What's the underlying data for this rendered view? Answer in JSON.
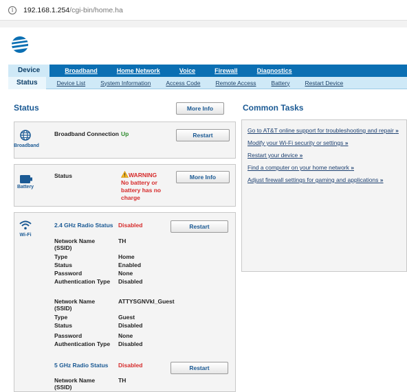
{
  "browser": {
    "url_host": "192.168.1.254",
    "url_path": "/cgi-bin/home.ha",
    "info_icon": "info-icon"
  },
  "brand": {
    "logo_icon": "att-globe-logo",
    "color": "#0b6fb3"
  },
  "nav_primary": [
    {
      "label": "Device",
      "active": true
    },
    {
      "label": "Broadband"
    },
    {
      "label": "Home Network"
    },
    {
      "label": "Voice"
    },
    {
      "label": "Firewall"
    },
    {
      "label": "Diagnostics"
    }
  ],
  "nav_secondary": [
    {
      "label": "Status",
      "active": true
    },
    {
      "label": "Device List"
    },
    {
      "label": "System Information"
    },
    {
      "label": "Access Code"
    },
    {
      "label": "Remote Access"
    },
    {
      "label": "Battery"
    },
    {
      "label": "Restart Device"
    }
  ],
  "status": {
    "title": "Status",
    "more_info": "More Info",
    "broadband": {
      "icon": "globe-icon",
      "icon_label": "Broadband",
      "label": "Broadband Connection",
      "value": "Up",
      "button": "Restart"
    },
    "battery": {
      "icon": "battery-icon",
      "icon_label": "Battery",
      "label": "Status",
      "warning_title": "WARNING",
      "warning_lines": [
        "No battery or",
        "battery has no",
        "charge"
      ],
      "button": "More Info"
    },
    "wifi": {
      "icon": "wifi-icon",
      "icon_label": "Wi-Fi",
      "radio24_label": "2.4 GHz Radio Status",
      "radio24_value": "Disabled",
      "radio24_button": "Restart",
      "network1": {
        "name_label": "Network Name",
        "name_label2": "(SSID)",
        "name": "TH",
        "type_label": "Type",
        "type": "Home",
        "status_label": "Status",
        "status": "Enabled",
        "password_label": "Password",
        "password": "None",
        "auth_label": "Authentication Type",
        "auth": "Disabled"
      },
      "network2": {
        "name_label": "Network Name",
        "name_label2": "(SSID)",
        "name": "ATTYSGNVkI_Guest",
        "type_label": "Type",
        "type": "Guest",
        "status_label": "Status",
        "status": "Disabled",
        "password_label": "Password",
        "password": "None",
        "auth_label": "Authentication Type",
        "auth": "Disabled"
      },
      "radio5_label": "5 GHz Radio Status",
      "radio5_value": "Disabled",
      "radio5_button": "Restart",
      "network3": {
        "name_label": "Network Name",
        "name_label2": "(SSID)",
        "name": "TH"
      }
    }
  },
  "common_tasks": {
    "title": "Common Tasks",
    "items": [
      {
        "label": "Go to AT&T online support for troubleshooting and repair",
        "arrow": "»"
      },
      {
        "label": "Modify your Wi-Fi security or settings",
        "arrow": "»"
      },
      {
        "label": "Restart your device",
        "arrow": "»"
      },
      {
        "label": "Find a computer on your home network",
        "arrow": "»"
      },
      {
        "label": "Adjust firewall settings for gaming and applications",
        "arrow": "»"
      }
    ]
  }
}
